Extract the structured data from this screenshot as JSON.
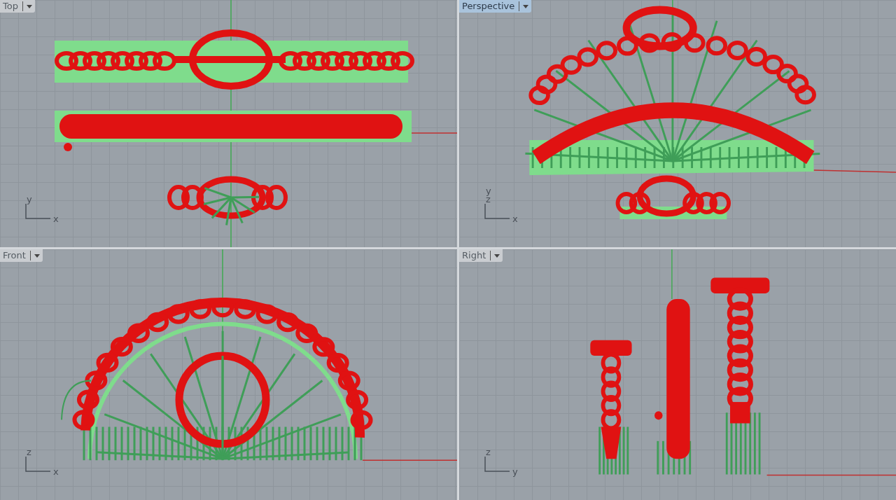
{
  "viewports": [
    {
      "title": "Top",
      "selected": false,
      "kind": "top",
      "axes": {
        "vertical": [
          "y"
        ],
        "horizontal": "x"
      }
    },
    {
      "title": "Perspective",
      "selected": true,
      "kind": "perspective",
      "axes": {
        "vertical": [
          "y",
          "z"
        ],
        "horizontal": "x"
      }
    },
    {
      "title": "Front",
      "selected": false,
      "kind": "front",
      "axes": {
        "vertical": [
          "z"
        ],
        "horizontal": "x"
      }
    },
    {
      "title": "Right",
      "selected": false,
      "kind": "right",
      "axes": {
        "vertical": [
          "z"
        ],
        "horizontal": "y"
      }
    }
  ]
}
